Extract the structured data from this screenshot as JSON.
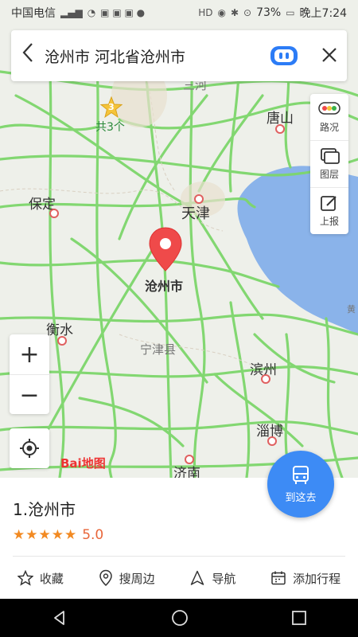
{
  "status_bar": {
    "carrier": "中国电信",
    "battery": "73%",
    "time": "晚上7:24"
  },
  "search_bar": {
    "query": "沧州市 河北省沧州市",
    "back_icon": "chevron-left-icon",
    "assistant_icon": "robot-icon",
    "close_icon": "close-icon"
  },
  "side_panel": {
    "items": [
      {
        "label": "路况",
        "icon": "traffic-icon"
      },
      {
        "label": "图层",
        "icon": "layers-icon"
      },
      {
        "label": "上报",
        "icon": "report-icon"
      }
    ]
  },
  "map": {
    "labels": {
      "sanhe": "三河",
      "tangshan": "唐山",
      "baoding": "保定",
      "tianjin": "天津",
      "cangzhou": "沧州市",
      "hengshui": "衡水",
      "ningjin": "宁津县",
      "binzhou": "滨州",
      "zibo": "淄博",
      "jinan": "济南",
      "huang": "黄"
    },
    "cluster": {
      "count": "3",
      "label": "共3个"
    },
    "logo": "Bai地图"
  },
  "zoom": {
    "in": "+",
    "out": "−"
  },
  "goto_button": {
    "label": "到这去"
  },
  "place_card": {
    "title": "1.沧州市",
    "stars": "★★★★★",
    "score": "5.0",
    "actions": [
      {
        "label": "收藏",
        "icon": "star-outline-icon"
      },
      {
        "label": "搜周边",
        "icon": "location-pin-icon"
      },
      {
        "label": "导航",
        "icon": "navigation-icon"
      },
      {
        "label": "添加行程",
        "icon": "calendar-icon"
      }
    ]
  },
  "colors": {
    "accent": "#3d8bf5",
    "pin": "#ef4a4a",
    "road": "#7dd66b",
    "sea": "#8ab3ea"
  }
}
